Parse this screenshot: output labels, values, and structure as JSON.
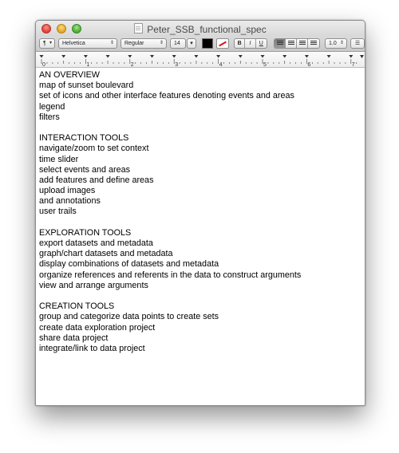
{
  "window": {
    "title": "Peter_SSB_functional_spec"
  },
  "toolbar": {
    "paragraph_style": "¶",
    "font_family": "Helvetica",
    "typeface": "Regular",
    "font_size": "14",
    "text_color": "#000000",
    "bold": "B",
    "italic": "I",
    "underline": "U",
    "line_spacing": "1.0"
  },
  "ruler": {
    "numbers": [
      "0",
      "1",
      "2",
      "3",
      "4",
      "5",
      "6",
      "7"
    ]
  },
  "document": {
    "lines": [
      "AN OVERVIEW",
      "map of sunset boulevard",
      "set of icons and other interface features denoting events and areas",
      "legend",
      "filters",
      "",
      "INTERACTION TOOLS",
      "navigate/zoom to set context",
      "time slider",
      "select events and areas",
      "add features and define areas",
      "upload images",
      "and annotations",
      "user trails",
      "",
      "EXPLORATION TOOLS",
      "export datasets and metadata",
      "graph/chart datasets and metadata",
      "display combinations of datasets and metadata",
      "organize references and referents in the data to construct arguments",
      "view and arrange arguments",
      "",
      "CREATION TOOLS",
      "group and categorize data points to create sets",
      "create data exploration project",
      "share data project",
      "integrate/link to data project"
    ]
  }
}
